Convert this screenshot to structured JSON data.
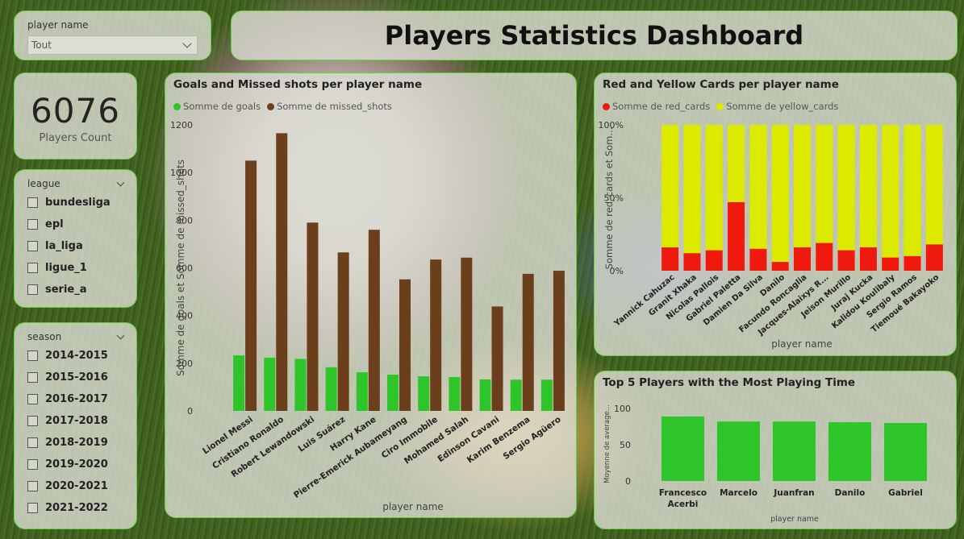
{
  "dashboard_title": "Players Statistics Dashboard",
  "player_slicer": {
    "label": "player name",
    "selected": "Tout"
  },
  "kpi": {
    "value": "6076",
    "label": "Players Count"
  },
  "league_slicer": {
    "label": "league",
    "options": [
      "bundesliga",
      "epl",
      "la_liga",
      "ligue_1",
      "serie_a"
    ]
  },
  "season_slicer": {
    "label": "season",
    "options": [
      "2014-2015",
      "2015-2016",
      "2016-2017",
      "2017-2018",
      "2018-2019",
      "2019-2020",
      "2020-2021",
      "2021-2022"
    ]
  },
  "colors": {
    "green": "#2ec52b",
    "brown": "#6b3f1c",
    "red": "#f0190e",
    "yellow": "#dcea00",
    "accent_border": "#5fd23c"
  },
  "chart_data": [
    {
      "type": "bar",
      "title": "Goals and Missed shots per player name",
      "xlabel": "player name",
      "ylabel": "Somme de goals et Somme de missed_shots",
      "ylim": [
        0,
        1200
      ],
      "yticks": [
        "0",
        "200",
        "400",
        "600",
        "800",
        "1000",
        "1200"
      ],
      "legend_position": "top-left",
      "categories": [
        "Lionel Messi",
        "Cristiano Ronaldo",
        "Robert Lewandowski",
        "Luis Suárez",
        "Harry Kane",
        "Pierre-Emerick Aubameyang",
        "Ciro Immobile",
        "Mohamed Salah",
        "Edinson Cavani",
        "Karim Benzema",
        "Sergio Agüero"
      ],
      "series": [
        {
          "name": "Somme de goals",
          "values": [
            233,
            223,
            218,
            183,
            162,
            152,
            145,
            142,
            132,
            131,
            131
          ]
        },
        {
          "name": "Somme de missed_shots",
          "values": [
            1050,
            1165,
            790,
            665,
            760,
            552,
            635,
            643,
            438,
            575,
            588
          ]
        }
      ]
    },
    {
      "type": "bar",
      "stacked": "100%",
      "title": "Red and Yellow Cards per player name",
      "xlabel": "player name",
      "ylabel": "Somme de red_cards et Som...",
      "yticks": [
        "0%",
        "50%",
        "100%"
      ],
      "legend_position": "top-left",
      "categories": [
        "Yannick Cahuzac",
        "Granit Xhaka",
        "Nicolas Pallois",
        "Gabriel Paletta",
        "Damien Da Silva",
        "Danilo",
        "Facundo Roncaglia",
        "Jacques-Alaixys R...",
        "Jeison Murillo",
        "Juraj Kucka",
        "Kalidou Koulibaly",
        "Sergio Ramos",
        "Tiemoué Bakayoko"
      ],
      "series": [
        {
          "name": "Somme de red_cards",
          "values": [
            0.16,
            0.12,
            0.14,
            0.47,
            0.15,
            0.06,
            0.16,
            0.19,
            0.14,
            0.16,
            0.09,
            0.1,
            0.18
          ]
        },
        {
          "name": "Somme de yellow_cards",
          "values": [
            0.84,
            0.88,
            0.86,
            0.53,
            0.85,
            0.94,
            0.84,
            0.81,
            0.86,
            0.84,
            0.91,
            0.9,
            0.82
          ]
        }
      ]
    },
    {
      "type": "bar",
      "title": "Top 5 Players with the Most Playing Time",
      "xlabel": "player name",
      "ylabel": "Moyenne de average...",
      "ylim": [
        0,
        110
      ],
      "yticks": [
        "0",
        "50",
        "100"
      ],
      "categories": [
        "Francesco Acerbi",
        "Marcelo",
        "Juanfran",
        "Danilo",
        "Gabriel"
      ],
      "series": [
        {
          "values": [
            89,
            82,
            82,
            81,
            80
          ]
        }
      ]
    }
  ]
}
